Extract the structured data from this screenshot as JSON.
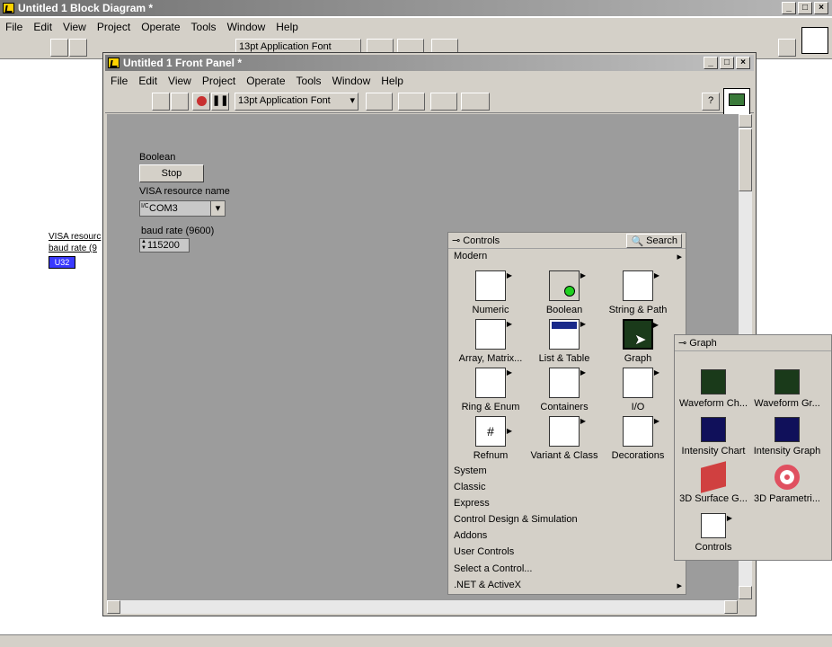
{
  "block_diagram": {
    "title": "Untitled 1 Block Diagram *",
    "menu": [
      "File",
      "Edit",
      "View",
      "Project",
      "Operate",
      "Tools",
      "Window",
      "Help"
    ],
    "font_select": "13pt Application Font",
    "node_labels": [
      "VISA resourc",
      "baud rate (9"
    ],
    "node_terminal": "U32"
  },
  "front_panel": {
    "title": "Untitled 1 Front Panel *",
    "menu": [
      "File",
      "Edit",
      "View",
      "Project",
      "Operate",
      "Tools",
      "Window",
      "Help"
    ],
    "font_select": "13pt Application Font",
    "controls": {
      "boolean_label": "Boolean",
      "boolean_button": "Stop",
      "visa_label": "VISA resource name",
      "visa_value": "COM3",
      "visa_prefix": "I/O",
      "baud_label": "baud rate (9600)",
      "baud_value": "115200"
    }
  },
  "controls_palette": {
    "title": "Controls",
    "search_label": "Search",
    "section": "Modern",
    "tiles": [
      {
        "label": "Numeric",
        "icon": "numeric-icon"
      },
      {
        "label": "Boolean",
        "icon": "boolean-icon"
      },
      {
        "label": "String & Path",
        "icon": "string-path-icon"
      },
      {
        "label": "Array, Matrix...",
        "icon": "array-matrix-icon"
      },
      {
        "label": "List & Table",
        "icon": "list-table-icon"
      },
      {
        "label": "Graph",
        "icon": "graph-icon"
      },
      {
        "label": "Ring & Enum",
        "icon": "ring-enum-icon"
      },
      {
        "label": "Containers",
        "icon": "containers-icon"
      },
      {
        "label": "I/O",
        "icon": "io-icon"
      },
      {
        "label": "Refnum",
        "icon": "refnum-icon"
      },
      {
        "label": "Variant & Class",
        "icon": "variant-class-icon"
      },
      {
        "label": "Decorations",
        "icon": "decorations-icon"
      }
    ],
    "categories": [
      "System",
      "Classic",
      "Express",
      "Control Design & Simulation",
      "Addons",
      "User Controls",
      "Select a Control...",
      ".NET & ActiveX"
    ]
  },
  "graph_palette": {
    "title": "Graph",
    "tiles": [
      {
        "label": "Waveform Ch...",
        "icon": "waveform-chart-icon"
      },
      {
        "label": "Waveform Gr...",
        "icon": "waveform-graph-icon"
      },
      {
        "label": "Intensity Chart",
        "icon": "intensity-chart-icon"
      },
      {
        "label": "Intensity Graph",
        "icon": "intensity-graph-icon"
      },
      {
        "label": "3D Surface G...",
        "icon": "3d-surface-icon"
      },
      {
        "label": "3D Parametri...",
        "icon": "3d-parametric-icon"
      },
      {
        "label": "Controls",
        "icon": "controls-subpalette-icon"
      }
    ]
  }
}
